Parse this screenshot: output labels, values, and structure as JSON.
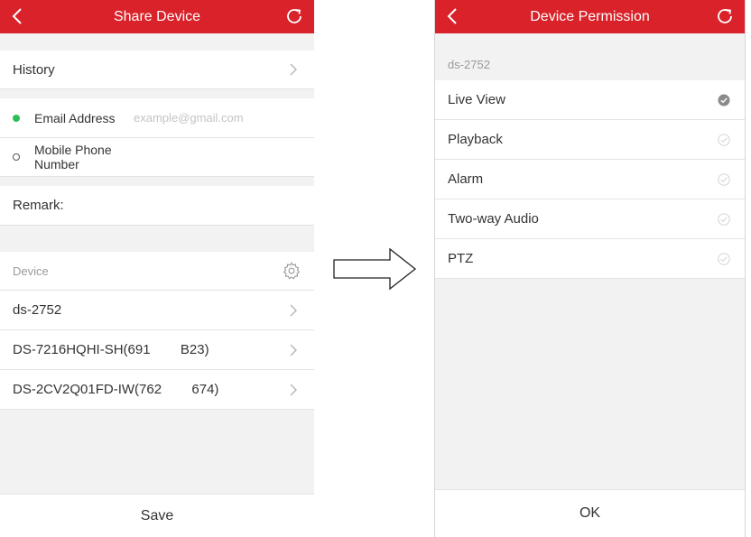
{
  "share_screen": {
    "title": "Share Device",
    "history_label": "History",
    "recipient_options": [
      {
        "label": "Email Address",
        "selected": true
      },
      {
        "label": "Mobile Phone Number",
        "selected": false
      }
    ],
    "email_placeholder": "example@gmail.com",
    "email_value": "",
    "remark_label": "Remark:",
    "device_section_label": "Device",
    "devices": [
      {
        "name": "ds-2752"
      },
      {
        "name": "DS-7216HQHI-SH(691        B23)"
      },
      {
        "name": "DS-2CV2Q01FD-IW(762        674)"
      }
    ],
    "save_label": "Save"
  },
  "permission_screen": {
    "title": "Device Permission",
    "device_name": "ds-2752",
    "permissions": [
      {
        "label": "Live View",
        "checked": true
      },
      {
        "label": "Playback",
        "checked": false
      },
      {
        "label": "Alarm",
        "checked": false
      },
      {
        "label": "Two-way Audio",
        "checked": false
      },
      {
        "label": "PTZ",
        "checked": false
      }
    ],
    "ok_label": "OK"
  },
  "colors": {
    "header_red": "#d9222a",
    "selected_green": "#2ebd59",
    "checked_gray": "#8a8a8a",
    "unchecked_gray": "#d0d0d0",
    "background": "#f2f2f2"
  },
  "icons": {
    "back": "chevron-left-icon",
    "refresh": "refresh-icon",
    "chevron": "chevron-right-icon",
    "gear": "gear-icon",
    "check": "check-circle-icon",
    "arrow": "right-arrow-icon"
  }
}
